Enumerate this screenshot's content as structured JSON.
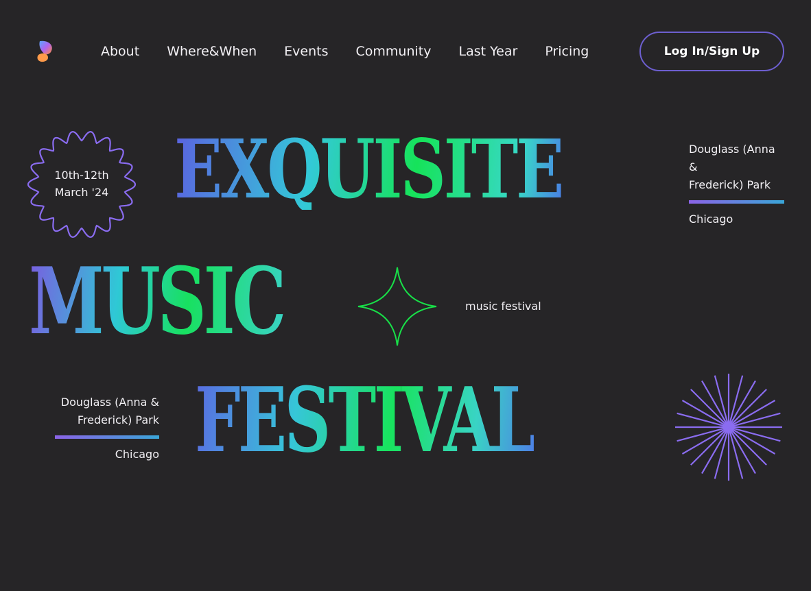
{
  "header": {
    "logo_icon": "butterfly-logo-icon",
    "nav": [
      {
        "label": "About"
      },
      {
        "label": "Where&When"
      },
      {
        "label": "Events"
      },
      {
        "label": "Community"
      },
      {
        "label": "Last Year"
      },
      {
        "label": "Pricing"
      }
    ],
    "login_label": "Log In/Sign Up"
  },
  "hero": {
    "word1": "EXQUISITE",
    "word2": "MUSIC",
    "word3": "FESTIVAL",
    "badge": {
      "line1": "10th-12th",
      "line2": "March '24",
      "icon": "flower-badge-icon"
    },
    "tagline": "music festival",
    "sparkle_icon": "four-point-star-icon",
    "burst_icon": "starburst-icon",
    "venue_right": {
      "line1": "Douglass (Anna",
      "line2": "&",
      "line3": "Frederick) Park",
      "city": "Chicago"
    },
    "venue_left": {
      "line1": "Douglass (Anna &",
      "line2": "Frederick) Park",
      "city": "Chicago"
    }
  },
  "colors": {
    "background": "#262527",
    "accent_purple": "#8b63e6",
    "accent_green": "#16e35a",
    "accent_cyan": "#33c9d8"
  }
}
